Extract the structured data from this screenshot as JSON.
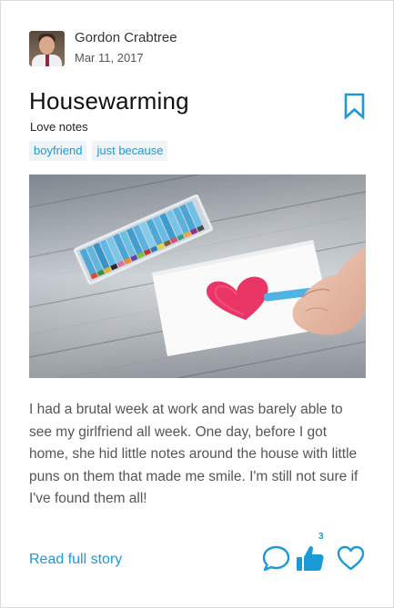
{
  "author": {
    "name": "Gordon Crabtree",
    "date": "Mar 11, 2017"
  },
  "post": {
    "title": "Housewarming",
    "category": "Love notes",
    "tags": [
      "boyfriend",
      "just because"
    ],
    "excerpt": "I had a brutal week at work and was barely able to see my girlfriend all week. One day, before I got home, she hid little notes around the house with little puns on them that made me smile. I'm still not sure if I've found them all!"
  },
  "actions": {
    "read_more_label": "Read full story",
    "like_count": "3"
  },
  "icons": {
    "bookmark": "bookmark-icon",
    "comment": "comment-icon",
    "like": "thumbs-up-icon",
    "heart": "heart-icon"
  },
  "colors": {
    "accent": "#1a9bd7",
    "tag_background": "#eef4f8",
    "heart_drawing": "#e8245a"
  }
}
